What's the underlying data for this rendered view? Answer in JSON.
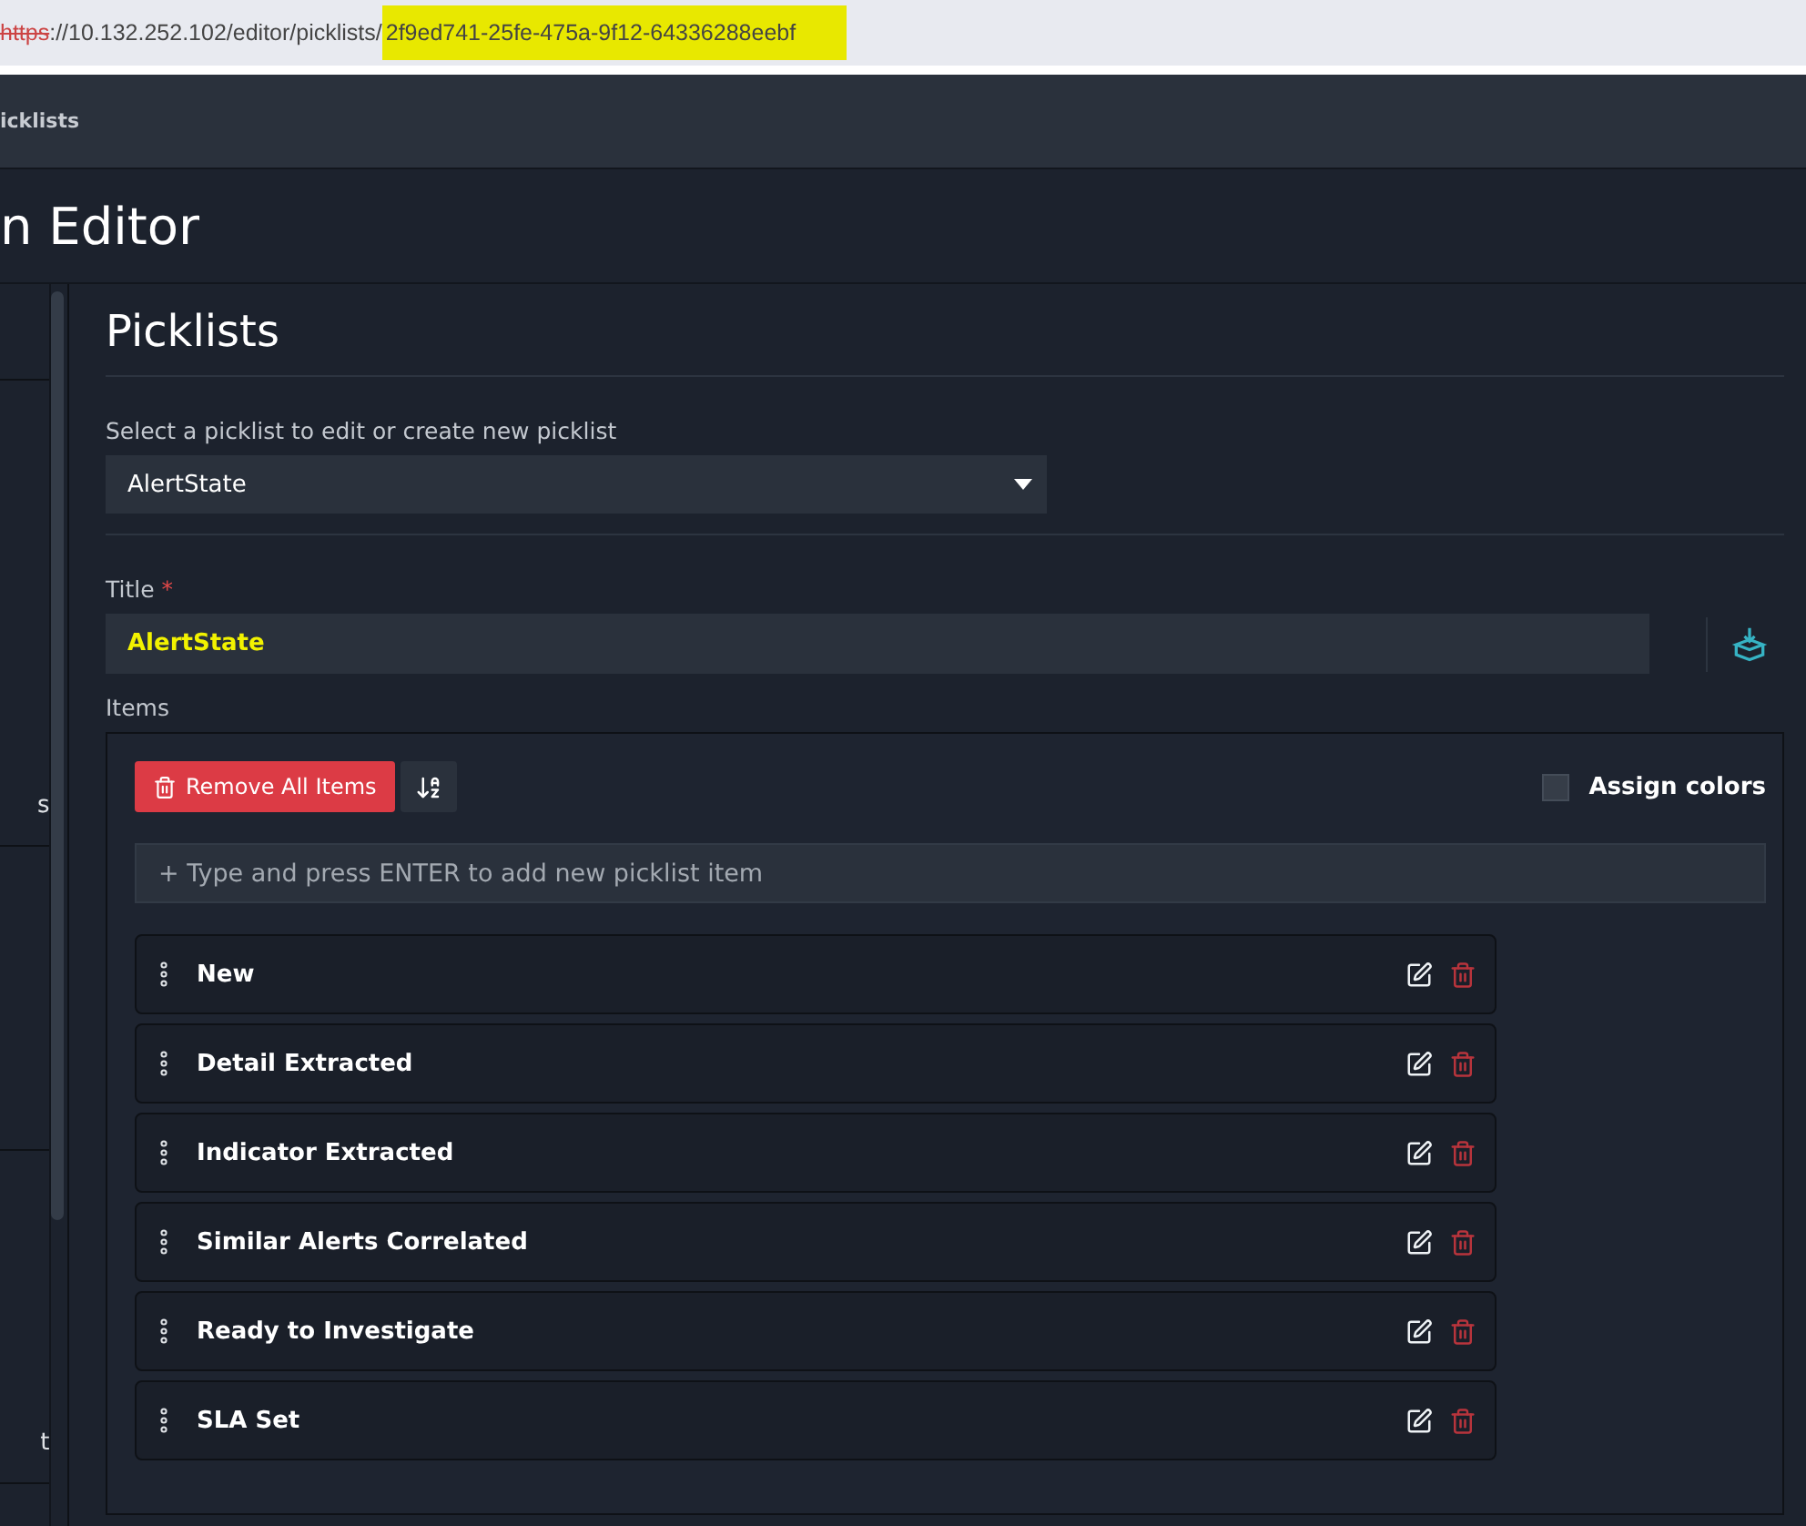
{
  "address_bar": {
    "scheme": "https",
    "path": "://10.132.252.102/editor/picklists/",
    "highlighted": "2f9ed741-25fe-475a-9f12-64336288eebf"
  },
  "breadcrumb": "icklists",
  "page_title": "n Editor",
  "sidebar": {
    "items": [
      {
        "label": "s"
      },
      {
        "label": "t"
      }
    ]
  },
  "section_title": "Picklists",
  "picklist_select": {
    "label": "Select a picklist to edit or create new picklist",
    "value": "AlertState"
  },
  "title_field": {
    "label": "Title",
    "required": true,
    "required_mark": "*",
    "value": "AlertState",
    "highlighted": true
  },
  "items_label": "Items",
  "remove_all_button": "Remove All Items",
  "assign_colors": {
    "label": "Assign colors",
    "checked": false
  },
  "new_item_input": {
    "placeholder": "+ Type and press ENTER to add new picklist item"
  },
  "items": [
    {
      "label": "New"
    },
    {
      "label": "Detail Extracted"
    },
    {
      "label": "Indicator Extracted"
    },
    {
      "label": "Similar Alerts Correlated"
    },
    {
      "label": "Ready to Investigate"
    },
    {
      "label": "SLA Set"
    }
  ]
}
